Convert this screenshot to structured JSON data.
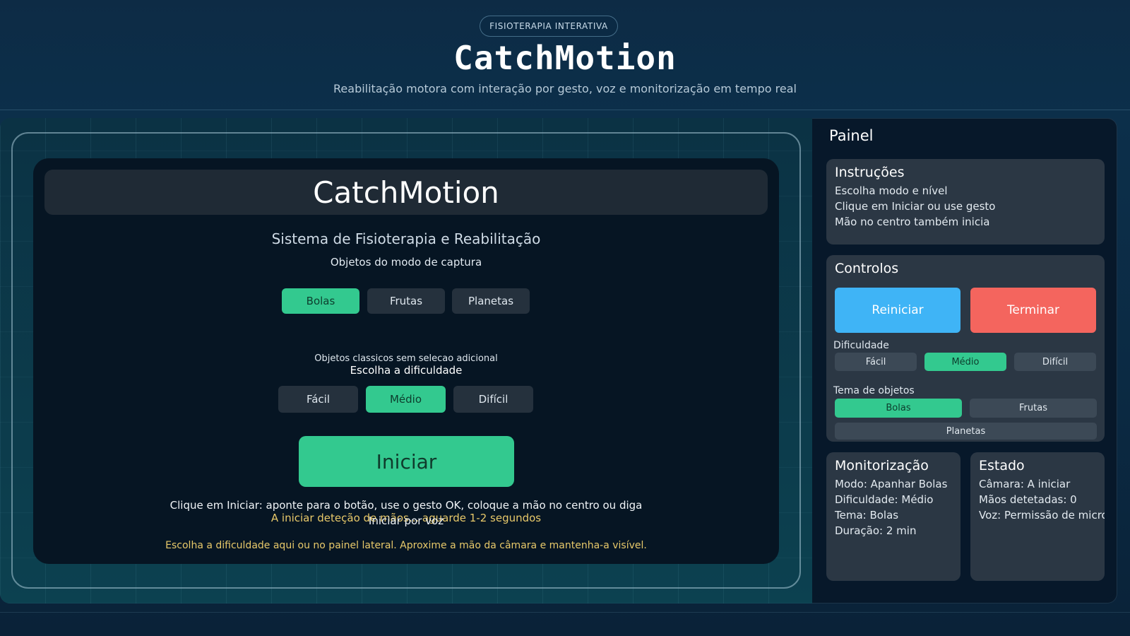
{
  "header": {
    "badge": "FISIOTERAPIA INTERATIVA",
    "title": "CatchMotion",
    "subtitle": "Reabilitação motora com interação por gesto, voz e monitorização em tempo real"
  },
  "game": {
    "title": "CatchMotion",
    "system_title": "Sistema de Fisioterapia e Reabilitação",
    "modes_label": "Objetos do modo de captura",
    "object_options": [
      "Bolas",
      "Frutas",
      "Planetas"
    ],
    "object_selected": "Bolas",
    "classic_note": "Objetos classicos sem selecao adicional",
    "difficulty_label": "Escolha a dificuldade",
    "difficulty_options": [
      "Fácil",
      "Médio",
      "Difícil"
    ],
    "difficulty_selected": "Médio",
    "start_label": "Iniciar",
    "hint": "Clique em Iniciar: aponte para o botão, use o gesto OK, coloque a mão no centro ou diga",
    "hint_overlap": "Iniciar por voz",
    "detect_status": "A iniciar deteção de mãos... aguarde 1-2 segundos",
    "bottom_note": "Escolha a dificuldade aqui ou no painel lateral. Aproxime a mão da câmara e mantenha-a visível."
  },
  "panel": {
    "title": "Painel",
    "instructions": {
      "title": "Instruções",
      "lines": [
        "Escolha modo e nível",
        "Clique em Iniciar ou use gesto",
        "Mão no centro também inicia"
      ]
    },
    "controls": {
      "title": "Controlos",
      "restart_label": "Reiniciar",
      "end_label": "Terminar",
      "difficulty_label": "Dificuldade",
      "difficulty_options": [
        "Fácil",
        "Médio",
        "Difícil"
      ],
      "difficulty_selected": "Médio",
      "theme_label": "Tema de objetos",
      "theme_options": [
        "Bolas",
        "Frutas",
        "Planetas"
      ],
      "theme_selected": "Bolas"
    },
    "monitoring": {
      "title": "Monitorização",
      "lines": [
        "Modo: Apanhar Bolas",
        "Dificuldade: Médio",
        "Tema: Bolas",
        "Duração: 2 min"
      ]
    },
    "status": {
      "title": "Estado",
      "lines": [
        "Câmara: A iniciar",
        "Mãos detetadas: 0",
        "Voz: Permissão de microfone"
      ]
    }
  },
  "colors": {
    "accent_green": "#33c98f",
    "restart_blue": "#3fb4f6",
    "end_red": "#f4655e",
    "warning_yellow": "#e8c96a"
  }
}
